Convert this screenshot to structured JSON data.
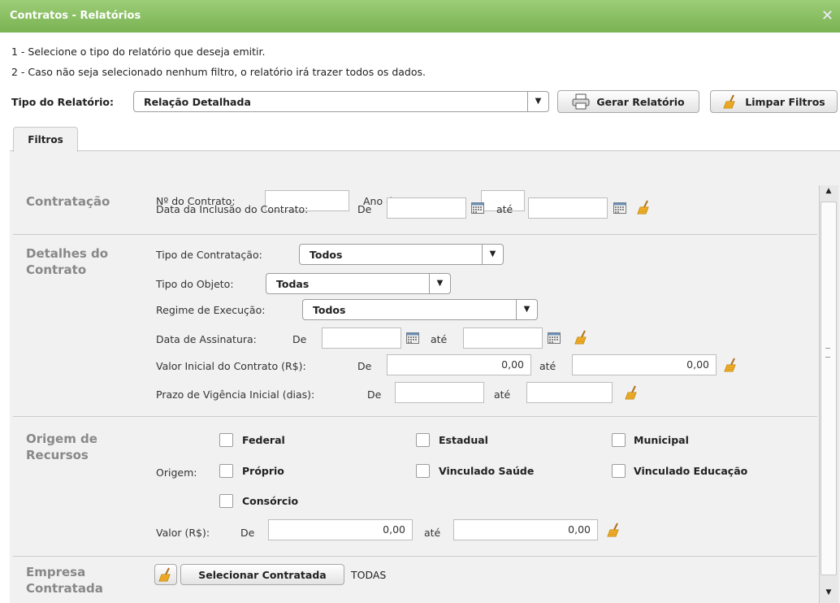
{
  "window": {
    "title": "Contratos - Relatórios",
    "close_glyph": "✕"
  },
  "instructions": [
    "1 - Selecione o tipo do relatório que deseja emitir.",
    "2 - Caso não seja selecionado nenhum filtro, o relatório irá trazer todos os dados."
  ],
  "toolbar": {
    "tipo_label": "Tipo do Relatório:",
    "tipo_value": "Relação Detalhada",
    "gerar_label": "Gerar Relatório",
    "limpar_label": "Limpar Filtros"
  },
  "tabs": [
    {
      "label": "Filtros"
    }
  ],
  "contratacao": {
    "title": "Contratação",
    "numero_label": "Nº do Contrato:",
    "ano_label": "Ano do Contrato:",
    "data_inclusao_label": "Data da Inclusão do Contrato:",
    "de_label": "De",
    "ate_label": "até"
  },
  "detalhes": {
    "title_line1": "Detalhes do",
    "title_line2": "Contrato",
    "tipo_contratacao_label": "Tipo de Contratação:",
    "tipo_contratacao_value": "Todos",
    "tipo_objeto_label": "Tipo do Objeto:",
    "tipo_objeto_value": "Todas",
    "regime_label": "Regime de Execução:",
    "regime_value": "Todos",
    "assinatura_label": "Data de Assinatura:",
    "valor_inicial_label": "Valor Inicial do Contrato (R$):",
    "valor_inicial_de": "0,00",
    "valor_inicial_ate": "0,00",
    "prazo_label": "Prazo de Vigência Inicial (dias):",
    "de_label": "De",
    "ate_label": "até"
  },
  "origem": {
    "title_line1": "Origem de",
    "title_line2": "Recursos",
    "origem_label": "Origem:",
    "options": [
      "Federal",
      "Estadual",
      "Municipal",
      "Próprio",
      "Vinculado Saúde",
      "Vinculado Educação",
      "Consórcio"
    ],
    "valor_label": "Valor (R$):",
    "valor_de": "0,00",
    "valor_ate": "0,00",
    "de_label": "De",
    "ate_label": "até"
  },
  "empresa": {
    "title_line1": "Empresa",
    "title_line2": "Contratada",
    "selecionar_label": "Selecionar Contratada",
    "selected_value": "TODAS"
  },
  "colors": {
    "titlebar": "#8cc063",
    "section_title": "#888888",
    "panel_bg": "#f1f1f1"
  }
}
